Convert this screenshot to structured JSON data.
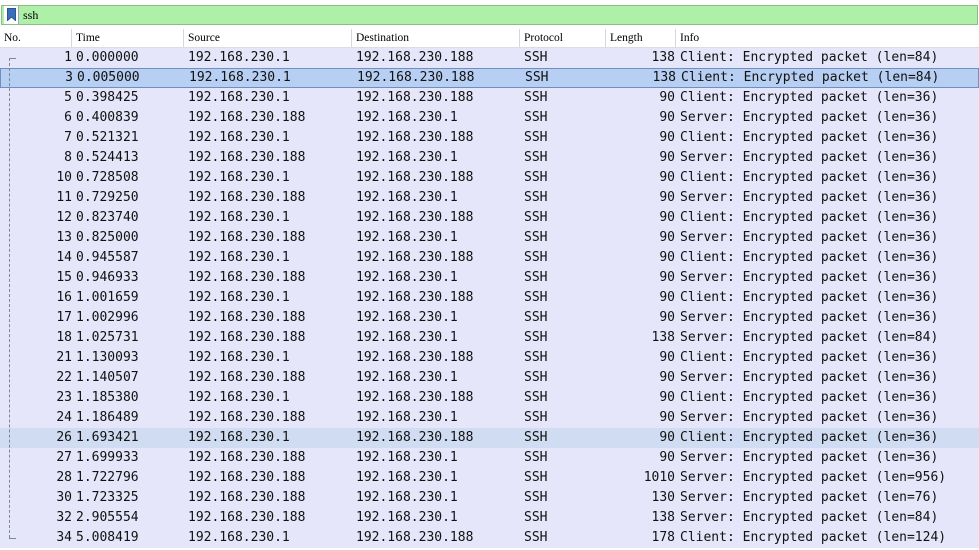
{
  "filter": {
    "text": "ssh",
    "bookmark_icon": "bookmark-icon"
  },
  "columns": [
    "No.",
    "Time",
    "Source",
    "Destination",
    "Protocol",
    "Length",
    "Info"
  ],
  "colors": {
    "filter_valid": "#aff0a8",
    "row_bg": "#e6e6fa",
    "row_selected": "#b7cff2",
    "row_related": "#d0dcf2"
  },
  "packets": [
    {
      "no": "1",
      "time": "0.000000",
      "source": "192.168.230.1",
      "destination": "192.168.230.188",
      "protocol": "SSH",
      "length": "138",
      "info": "Client: Encrypted packet (len=84)"
    },
    {
      "no": "3",
      "time": "0.005000",
      "source": "192.168.230.1",
      "destination": "192.168.230.188",
      "protocol": "SSH",
      "length": "138",
      "info": "Client: Encrypted packet (len=84)",
      "selected": true
    },
    {
      "no": "5",
      "time": "0.398425",
      "source": "192.168.230.1",
      "destination": "192.168.230.188",
      "protocol": "SSH",
      "length": "90",
      "info": "Client: Encrypted packet (len=36)"
    },
    {
      "no": "6",
      "time": "0.400839",
      "source": "192.168.230.188",
      "destination": "192.168.230.1",
      "protocol": "SSH",
      "length": "90",
      "info": "Server: Encrypted packet (len=36)"
    },
    {
      "no": "7",
      "time": "0.521321",
      "source": "192.168.230.1",
      "destination": "192.168.230.188",
      "protocol": "SSH",
      "length": "90",
      "info": "Client: Encrypted packet (len=36)"
    },
    {
      "no": "8",
      "time": "0.524413",
      "source": "192.168.230.188",
      "destination": "192.168.230.1",
      "protocol": "SSH",
      "length": "90",
      "info": "Server: Encrypted packet (len=36)"
    },
    {
      "no": "10",
      "time": "0.728508",
      "source": "192.168.230.1",
      "destination": "192.168.230.188",
      "protocol": "SSH",
      "length": "90",
      "info": "Client: Encrypted packet (len=36)"
    },
    {
      "no": "11",
      "time": "0.729250",
      "source": "192.168.230.188",
      "destination": "192.168.230.1",
      "protocol": "SSH",
      "length": "90",
      "info": "Server: Encrypted packet (len=36)"
    },
    {
      "no": "12",
      "time": "0.823740",
      "source": "192.168.230.1",
      "destination": "192.168.230.188",
      "protocol": "SSH",
      "length": "90",
      "info": "Client: Encrypted packet (len=36)"
    },
    {
      "no": "13",
      "time": "0.825000",
      "source": "192.168.230.188",
      "destination": "192.168.230.1",
      "protocol": "SSH",
      "length": "90",
      "info": "Server: Encrypted packet (len=36)"
    },
    {
      "no": "14",
      "time": "0.945587",
      "source": "192.168.230.1",
      "destination": "192.168.230.188",
      "protocol": "SSH",
      "length": "90",
      "info": "Client: Encrypted packet (len=36)"
    },
    {
      "no": "15",
      "time": "0.946933",
      "source": "192.168.230.188",
      "destination": "192.168.230.1",
      "protocol": "SSH",
      "length": "90",
      "info": "Server: Encrypted packet (len=36)"
    },
    {
      "no": "16",
      "time": "1.001659",
      "source": "192.168.230.1",
      "destination": "192.168.230.188",
      "protocol": "SSH",
      "length": "90",
      "info": "Client: Encrypted packet (len=36)"
    },
    {
      "no": "17",
      "time": "1.002996",
      "source": "192.168.230.188",
      "destination": "192.168.230.1",
      "protocol": "SSH",
      "length": "90",
      "info": "Server: Encrypted packet (len=36)"
    },
    {
      "no": "18",
      "time": "1.025731",
      "source": "192.168.230.188",
      "destination": "192.168.230.1",
      "protocol": "SSH",
      "length": "138",
      "info": "Server: Encrypted packet (len=84)"
    },
    {
      "no": "21",
      "time": "1.130093",
      "source": "192.168.230.1",
      "destination": "192.168.230.188",
      "protocol": "SSH",
      "length": "90",
      "info": "Client: Encrypted packet (len=36)"
    },
    {
      "no": "22",
      "time": "1.140507",
      "source": "192.168.230.188",
      "destination": "192.168.230.1",
      "protocol": "SSH",
      "length": "90",
      "info": "Server: Encrypted packet (len=36)"
    },
    {
      "no": "23",
      "time": "1.185380",
      "source": "192.168.230.1",
      "destination": "192.168.230.188",
      "protocol": "SSH",
      "length": "90",
      "info": "Client: Encrypted packet (len=36)"
    },
    {
      "no": "24",
      "time": "1.186489",
      "source": "192.168.230.188",
      "destination": "192.168.230.1",
      "protocol": "SSH",
      "length": "90",
      "info": "Server: Encrypted packet (len=36)"
    },
    {
      "no": "26",
      "time": "1.693421",
      "source": "192.168.230.1",
      "destination": "192.168.230.188",
      "protocol": "SSH",
      "length": "90",
      "info": "Client: Encrypted packet (len=36)",
      "related": true
    },
    {
      "no": "27",
      "time": "1.699933",
      "source": "192.168.230.188",
      "destination": "192.168.230.1",
      "protocol": "SSH",
      "length": "90",
      "info": "Server: Encrypted packet (len=36)"
    },
    {
      "no": "28",
      "time": "1.722796",
      "source": "192.168.230.188",
      "destination": "192.168.230.1",
      "protocol": "SSH",
      "length": "1010",
      "info": "Server: Encrypted packet (len=956)"
    },
    {
      "no": "30",
      "time": "1.723325",
      "source": "192.168.230.188",
      "destination": "192.168.230.1",
      "protocol": "SSH",
      "length": "130",
      "info": "Server: Encrypted packet (len=76)"
    },
    {
      "no": "32",
      "time": "2.905554",
      "source": "192.168.230.188",
      "destination": "192.168.230.1",
      "protocol": "SSH",
      "length": "138",
      "info": "Server: Encrypted packet (len=84)"
    },
    {
      "no": "34",
      "time": "5.008419",
      "source": "192.168.230.1",
      "destination": "192.168.230.188",
      "protocol": "SSH",
      "length": "178",
      "info": "Client: Encrypted packet (len=124)"
    }
  ]
}
